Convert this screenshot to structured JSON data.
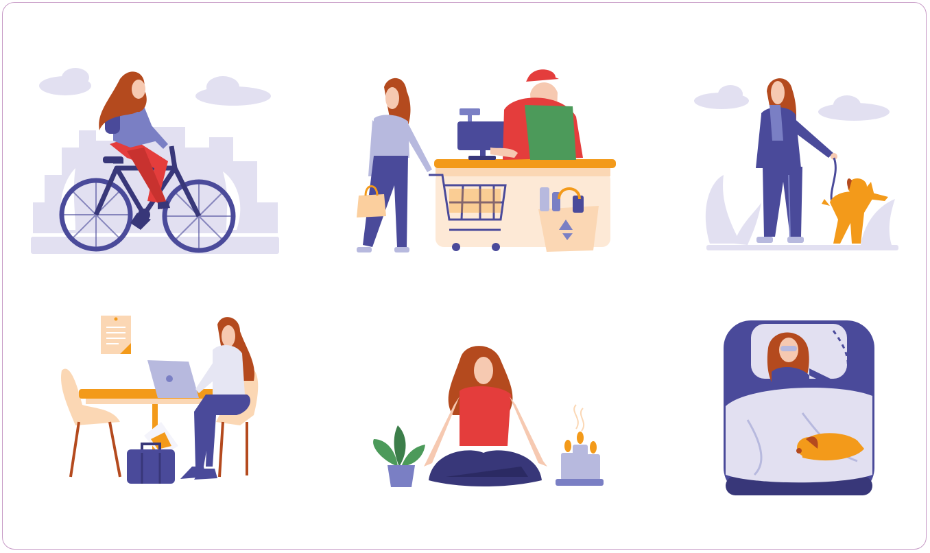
{
  "colors": {
    "frame_border": "#c79ac6",
    "lavender_light": "#e2e0f1",
    "navy": "#4a4a9a",
    "navy_dark": "#383779",
    "hair": "#b44a1e",
    "skin": "#f6c9b1",
    "red": "#e43d3c",
    "orange": "#f39a1a",
    "green": "#4c9a5a",
    "cream": "#fde9d6"
  },
  "scenes": [
    {
      "id": "cycling",
      "icon": "woman-riding-bicycle"
    },
    {
      "id": "shopping",
      "icon": "woman-at-grocery-checkout"
    },
    {
      "id": "dog-walk",
      "icon": "woman-walking-dog"
    },
    {
      "id": "working",
      "icon": "woman-working-on-laptop"
    },
    {
      "id": "meditation",
      "icon": "woman-meditating"
    },
    {
      "id": "sleeping",
      "icon": "woman-sleeping-with-dog"
    }
  ]
}
